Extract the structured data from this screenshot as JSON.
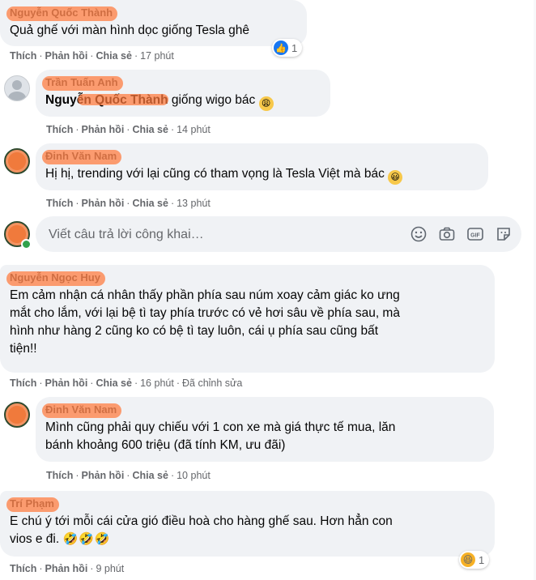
{
  "comments": [
    {
      "name": "Nguyễn Quốc Thành",
      "text": "Quả ghế với màn hình dọc giống Tesla ghê",
      "actions": {
        "like": "Thích",
        "reply": "Phản hồi",
        "share": "Chia sẻ",
        "time": "17 phút"
      },
      "reaction": {
        "icon": "like-icon",
        "count": "1"
      }
    },
    {
      "name": "Trần Tuấn Anh",
      "mention": "Nguyễn Quốc Thành",
      "text": " giống wigo bác ",
      "emoji": "😩",
      "actions": {
        "like": "Thích",
        "reply": "Phản hồi",
        "share": "Chia sẻ",
        "time": "14 phút"
      }
    },
    {
      "name": "Đinh Văn Nam",
      "text": "Hị hị, trending với lại cũng có tham vọng là Tesla Việt mà bác ",
      "emoji": "😃",
      "actions": {
        "like": "Thích",
        "reply": "Phản hồi",
        "share": "Chia sẻ",
        "time": "13 phút"
      }
    },
    {
      "name": "Nguyễn Ngọc Huy",
      "text_lines": [
        "Em cảm nhận cá nhân thấy phần phía sau núm xoay cảm giác ko ưng",
        "mắt cho lắm, với lại bệ tì tay phía trước có vẻ hơi sâu về phía sau, mà",
        "hình như hàng 2 cũng ko có bệ tì tay luôn, cái ụ phía sau cũng bất",
        "tiện!!"
      ],
      "actions": {
        "like": "Thích",
        "reply": "Phản hồi",
        "share": "Chia sẻ",
        "time": "16 phút",
        "edited": "Đã chỉnh sửa"
      }
    },
    {
      "name": "Đinh Văn Nam",
      "text_lines": [
        "Mình cũng phải quy chiếu với 1 con xe mà giá thực tế mua, lăn",
        "bánh khoảng 600 triệu (đã tính KM, ưu đãi)"
      ],
      "actions": {
        "like": "Thích",
        "reply": "Phản hồi",
        "share": "Chia sẻ",
        "time": "10 phút"
      }
    },
    {
      "name": "Trí Phạm",
      "text_lines": [
        "E chú ý tới mỗi cái cửa gió điều hoà cho hàng ghế sau. Hơn hẳn con",
        "vios e đi. "
      ],
      "emojis": "🤣🤣🤣",
      "actions": {
        "like": "Thích",
        "reply": "Phản hồi",
        "time": "9 phút"
      },
      "reaction": {
        "icon": "haha-icon",
        "count": "1"
      }
    }
  ],
  "reply_box": {
    "placeholder": "Viết câu trả lời công khai…",
    "tools": [
      "emoji-icon",
      "camera-icon",
      "gif-icon",
      "sticker-icon"
    ]
  },
  "colors": {
    "bubble": "#f0f2f5",
    "meta": "#65676b",
    "like_blue": "#1877f2",
    "online": "#31a24c"
  }
}
